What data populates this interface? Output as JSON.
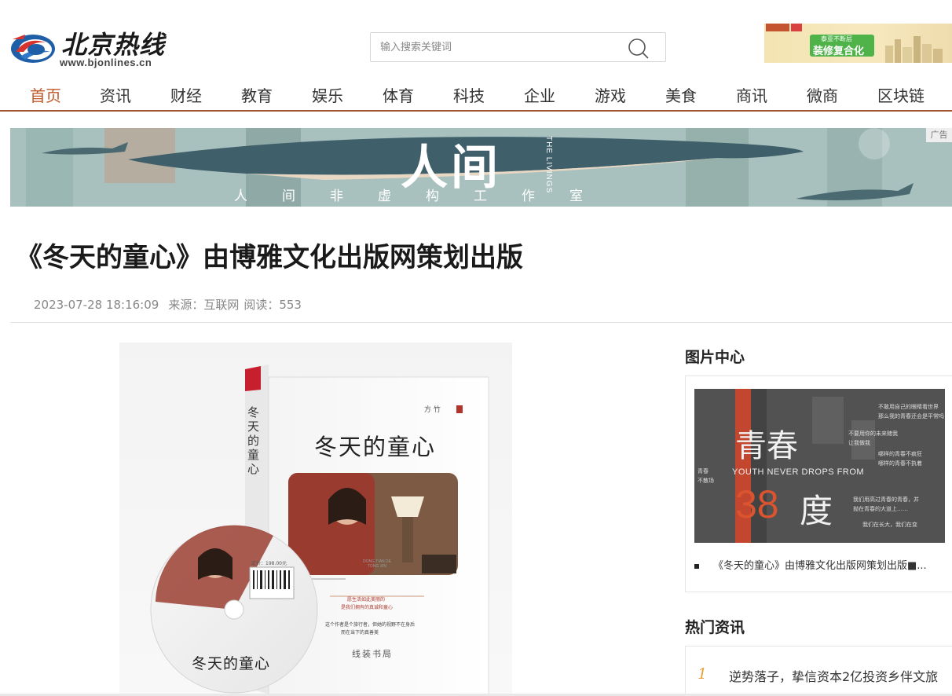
{
  "header": {
    "logo_text": "北京热线",
    "logo_url": "www.bjonlines.cn",
    "search_placeholder": "输入搜索关键词",
    "top_ad": {
      "sub": "泰亚不断层",
      "main": "装修复合化"
    }
  },
  "nav": {
    "items": [
      "首页",
      "资讯",
      "财经",
      "教育",
      "娱乐",
      "体育",
      "科技",
      "企业",
      "游戏",
      "美食",
      "商讯",
      "微商",
      "区块链"
    ],
    "active": "首页"
  },
  "banner": {
    "title": "人间",
    "side_text": "THE LIVINGS",
    "subtitle": "人间非虚构工作室",
    "ad_label": "广告"
  },
  "article": {
    "title": "《冬天的童心》由博雅文化出版网策划出版",
    "date": "2023-07-28 18:16:09",
    "source": "来源：互联网",
    "reads": "阅读：553"
  },
  "book": {
    "title": "冬天的童心",
    "spine_title": "冬天的童心",
    "author": "方 竹",
    "publisher": "线装书局",
    "cd_title": "冬天的童心",
    "price": "定价：198.00元",
    "pinyin": "DONG TIAN DE TONG XIN",
    "blurb1": "愿生活如此美丽的",
    "blurb2": "是我们拥有的真诚和童心",
    "blurb3": "这个作者是个旅行者，但她的视野不在身后",
    "blurb4": "而在当下的真善美"
  },
  "sidebar": {
    "pic_heading": "图片中心",
    "pic_caption": "《冬天的童心》由博雅文化出版网策划出版■...",
    "pic_poster": {
      "big1": "青春",
      "big2": "38",
      "big3": "度",
      "eng": "YOUTH NEVER DROPS FROM",
      "t1": "不敢用自己的眼睛看世界",
      "t2": "那么我的青春还会是平常吗",
      "t3": "不要用你的未来赌我",
      "t4": "让我做我",
      "t5": "哪样的青春不疯狂",
      "t6": "哪样的青春不执着",
      "t7": "我们用高过青春的青春，并",
      "t8": "抛在青春的大道上……",
      "t9": "我们在长大，我们在变",
      "left1": "青春",
      "left2": "不散场"
    },
    "hot_heading": "热门资讯",
    "hot_items": [
      {
        "num": "1",
        "text": "逆势落子，挚信资本2亿投资乡伴文旅"
      }
    ]
  },
  "colors": {
    "nav_active": "#c0582a",
    "nav_border": "#a0522d",
    "hot_number": "#e8a23a"
  }
}
